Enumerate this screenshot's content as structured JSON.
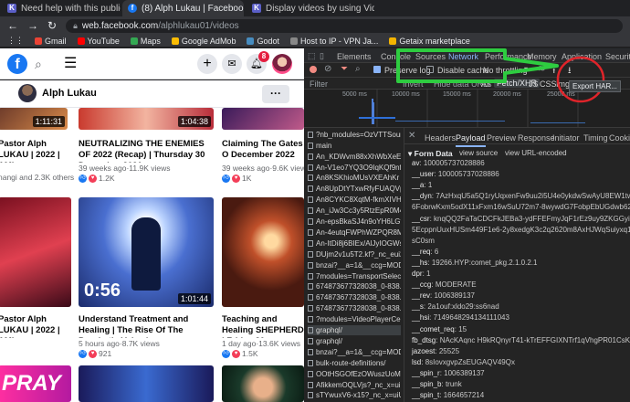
{
  "tabs": [
    {
      "title": "Need help with this public faceb",
      "favicon": "K",
      "color": "#5b5fc7"
    },
    {
      "title": "(8) Alph Lukau | Facebook",
      "favicon": "f",
      "color": "#1877f2"
    },
    {
      "title": "Display videos by using Video fr",
      "favicon": "K",
      "color": "#5b5fc7"
    }
  ],
  "address": {
    "domain": "web.facebook.com",
    "path": "/alphlukau01/videos"
  },
  "bookmarks": [
    {
      "label": "Gmail",
      "color": "#ea4335"
    },
    {
      "label": "YouTube",
      "color": "#ff0000"
    },
    {
      "label": "Maps",
      "color": "#34a853"
    },
    {
      "label": "Google AdMob",
      "color": "#fbbc04"
    },
    {
      "label": "Godot",
      "color": "#478cbf"
    },
    {
      "label": "Host to IP - VPN Ja...",
      "color": "#888888"
    },
    {
      "label": "Getaix marketplace",
      "color": "#f4b400"
    }
  ],
  "fb": {
    "notif_count": "8",
    "page_name": "Alph Lukau",
    "more_label": "···",
    "videos": [
      {
        "dur": "1:11:31",
        "title": "Pastor Alph LUKAU | 2022 | AMI...",
        "meta": "nangi and 2.3K others"
      },
      {
        "dur": "1:04:38",
        "title": "NEUTRALIZING THE ENEMIES OF 2022 (Recap) | Thursday 30 December 2021...",
        "meta": "39 weeks ago·11.9K views",
        "react": "1.2K"
      },
      {
        "dur": "",
        "title": "Claiming The Gates O December 2022",
        "meta": "39 weeks ago·9.6K views",
        "react": "1K"
      },
      {
        "dur": "",
        "title": "Pastor Alph LUKAU | 2022 | AMI...",
        "meta": ""
      },
      {
        "dur": "1:01:44",
        "bigdur": "0:56",
        "title": "Understand Treatment and Healing | The Rise Of The Prophetic Voice |...",
        "meta": "5 hours ago·8.7K views",
        "react": "921"
      },
      {
        "dur": "",
        "title": "Teaching and Healing SHEPHERD | Friday 30",
        "meta": "1 day ago·13.6K views",
        "react": "1.5K"
      }
    ],
    "bottom_text": "PRAY"
  },
  "devtools": {
    "tabs": [
      "Elements",
      "Console",
      "Sources",
      "Network",
      "Performance",
      "Memory",
      "Application",
      "Security"
    ],
    "preserve_log": "Preserve log",
    "disable_cache": "Disable cache",
    "throttle": "No throttling",
    "export_tooltip": "Export HAR...",
    "filter": "Filter",
    "filter_chips": [
      "Invert",
      "Hide data URLs",
      "All",
      "Fetch/XHR",
      "JS",
      "CSS",
      "Img"
    ],
    "timeline": [
      "5000 ms",
      "10000 ms",
      "15000 ms",
      "20000 ms",
      "25000 ms"
    ],
    "panel_tabs": [
      "Headers",
      "Payload",
      "Preview",
      "Response",
      "Initiator",
      "Timing",
      "Cookies"
    ],
    "requests": [
      "?nb_modules=OzVTTSource8",
      "main",
      "An_KDWvm88xXhWbXeEDam",
      "An-V1eo7YQ3O9IqKQf9nfo3z",
      "An8KSKhioMUsVXEAhKr",
      "An8UpDtYTxwRfyFUAQVpPL",
      "An8CYKC8XqtM-fkmXIVHrp9",
      "An_iJw3Cc3y5RtzEpR0M4CCz",
      "An-epsBkaSJ4n9oYH6LGfSPK",
      "An-4eutqFWPhWZPQR8MZu",
      "An-ItDi8j6BIEx/AlJyIOGWs0Ct",
      "DUjm2v1u5T2.kf?_nc_eui2=A",
      "bnzai?__a=1&__ccg=MODERA",
      "7modules=TransportSelecting",
      "674873677328038_0-838.m4",
      "674873677328038_0-838.m4",
      "674873677328038_0-838.m4",
      "?modules=VideoPlayerCea60",
      "graphql/",
      "graphql/",
      "bnzai?__a=1&__ccg=MODERA",
      "bulk-route-definitions/",
      "OOtHSGOfEzOWuszUoMVEZ",
      "AfikkemOQLVjs?_nc_x=uiUwl",
      "sTYwuxV6-x15?_nc_x=uiUwl"
    ],
    "form_header": "▾ Form Data",
    "view_source": "view source",
    "view_url": "view URL-encoded",
    "form": [
      [
        "av",
        "100005737028886"
      ],
      [
        "__user",
        "100005737028886"
      ],
      [
        "__a",
        "1"
      ],
      [
        "__dyn",
        "7AzHxqU5a5Q1ryUqxenFw9uu2i5U4e0ykdwSwAyU8EW1twYwJx5I3wJwpUe8hw6vwb-q7oc81xtwsxIwVxhU5uBx6aw"
      ],
      [
        "",
        "6FobrwKxm5odX11xFxm16wSuU72m7-8wywdG7FobpEbUGdwb62239m8O2J2nxNp9rmE0zqwpeHB7mE8U"
      ],
      [
        "__csr",
        "knqQQ2FaTaCDCFkJEBa3-ydFFEFmyJqF1rEz9uy9ZKGGyi8jbO6e3mZHV2SRe2..."
      ],
      [
        "",
        "5EcppnUuxHUSm449F1e6-2y8xedgK3c2q2620m8AxHJWqSuiyxq1CyjzoarG48gaz2o5"
      ],
      [
        "",
        "sC0sm"
      ],
      [
        "__req",
        "6"
      ],
      [
        "__hs",
        "19266.HYP:comet_pkg.2.1.0.2.1"
      ],
      [
        "dpr",
        "1"
      ],
      [
        "__ccg",
        "MODERATE"
      ],
      [
        "__rev",
        "1006389137"
      ],
      [
        "__s",
        "2a1ouf:xldo29:ss6nad"
      ],
      [
        "__hsi",
        "7149648294134111043"
      ],
      [
        "__comet_req",
        "15"
      ],
      [
        "fb_dtsg",
        "NAcKAqnc H9kRQnyrT41-kTrEFFGIXNTrf1qVhgPR01CsKY1LGNQ7Hg:"
      ],
      [
        "jazoest",
        "25525"
      ],
      [
        "lsd",
        "8sIovxgvpZsEUGAQV49Qx"
      ],
      [
        "__spin_r",
        "1006389137"
      ],
      [
        "__spin_b",
        "trunk"
      ],
      [
        "__spin_t",
        "1664657214"
      ]
    ]
  }
}
